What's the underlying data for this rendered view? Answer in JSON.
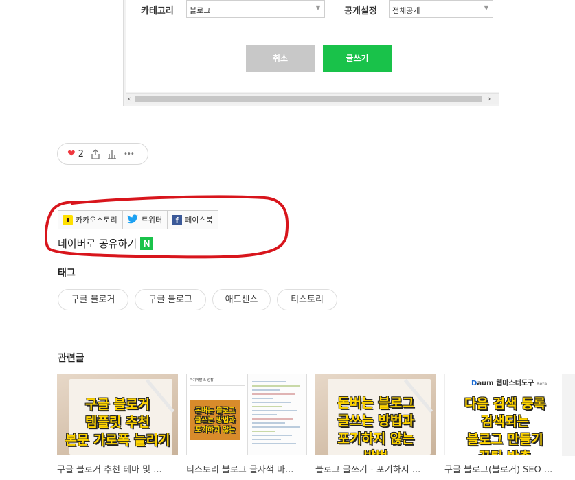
{
  "form": {
    "category_label": "카테고리",
    "category_value": "블로그",
    "visibility_label": "공개설정",
    "visibility_value": "전체공개",
    "cancel_label": "취소",
    "write_label": "글쓰기"
  },
  "reactions": {
    "like_count": "2",
    "more_label": "•••"
  },
  "share": {
    "kakaostory": "카카오스토리",
    "twitter": "트위터",
    "facebook": "페이스북",
    "naver": "네이버로 공유하기"
  },
  "tags": {
    "title": "태그",
    "items": [
      "구글 블로거",
      "구글 블로그",
      "애드센스",
      "티스토리"
    ]
  },
  "related": {
    "title": "관련글",
    "items": [
      {
        "title": "구글 블로거 추천 테마 및 ...",
        "thumb_lines": [
          "구글 블로거",
          "템플릿 추천",
          "본문 가로폭 늘리기"
        ]
      },
      {
        "title": "티스토리 블로그 글자색 바...",
        "thumb_lines": [
          "돈버는 블로그",
          "글쓰는 방법과",
          "포기하지 않는"
        ],
        "thumb_header": "가기계발 & 성장"
      },
      {
        "title": "블로그 글쓰기 - 포기하지 ...",
        "thumb_lines": [
          "돈버는 블로그",
          "글쓰는 방법과",
          "포기하지 않는",
          "방법"
        ]
      },
      {
        "title": "구글 블로그(블로거) SEO ...",
        "thumb_lines": [
          "다음 검색 등록",
          "검색되는",
          "블로그 만들기",
          "꿀팁 방출"
        ],
        "thumb_brand": "웹마스터도구",
        "thumb_badge": "Beta"
      }
    ]
  },
  "colors": {
    "write_button": "#19c24a",
    "cancel_button": "#c8c8c8",
    "annotation_circle": "#d8151c",
    "heart": "#f0383f",
    "thumb_text": "#ffd400"
  }
}
